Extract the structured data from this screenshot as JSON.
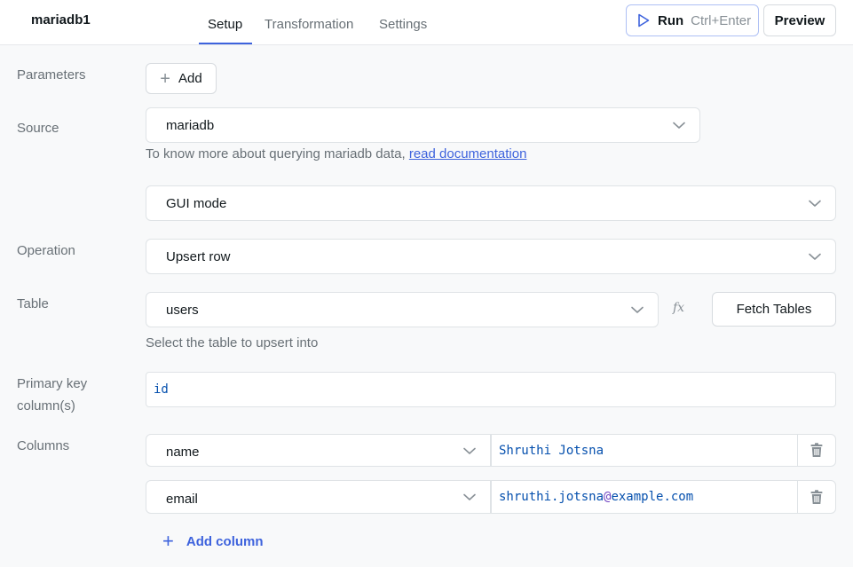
{
  "header": {
    "query_name": "mariadb1",
    "tabs": [
      {
        "label": "Setup",
        "active": true
      },
      {
        "label": "Transformation",
        "active": false
      },
      {
        "label": "Settings",
        "active": false
      }
    ],
    "run_label": "Run",
    "run_shortcut": "Ctrl+Enter",
    "preview_label": "Preview"
  },
  "parameters": {
    "label": "Parameters",
    "add_label": "Add"
  },
  "source": {
    "label": "Source",
    "value": "mariadb",
    "help_text": "To know more about querying mariadb data,",
    "help_link": "read documentation"
  },
  "mode": {
    "value": "GUI mode"
  },
  "operation": {
    "label": "Operation",
    "value": "Upsert row"
  },
  "table": {
    "label": "Table",
    "value": "users",
    "fx_label": "fx",
    "fetch_label": "Fetch Tables",
    "help_text": "Select the table to upsert into"
  },
  "primary_key": {
    "label_line1": "Primary key",
    "label_line2": "column(s)",
    "value": "id"
  },
  "columns": {
    "label": "Columns",
    "rows": [
      {
        "column": "name",
        "value": "Shruthi Jotsna"
      },
      {
        "column": "email",
        "value_user": "shruthi.jotsna",
        "value_at": "@",
        "value_domain": "example.com"
      }
    ],
    "add_label": "Add column"
  },
  "colors": {
    "accent": "#3e63dd",
    "muted": "#687076",
    "border": "#dfe3e6",
    "code": "#0550ae"
  },
  "icons": [
    "play-icon",
    "plus-icon",
    "chevron-down-icon",
    "fx-icon",
    "trash-icon"
  ]
}
